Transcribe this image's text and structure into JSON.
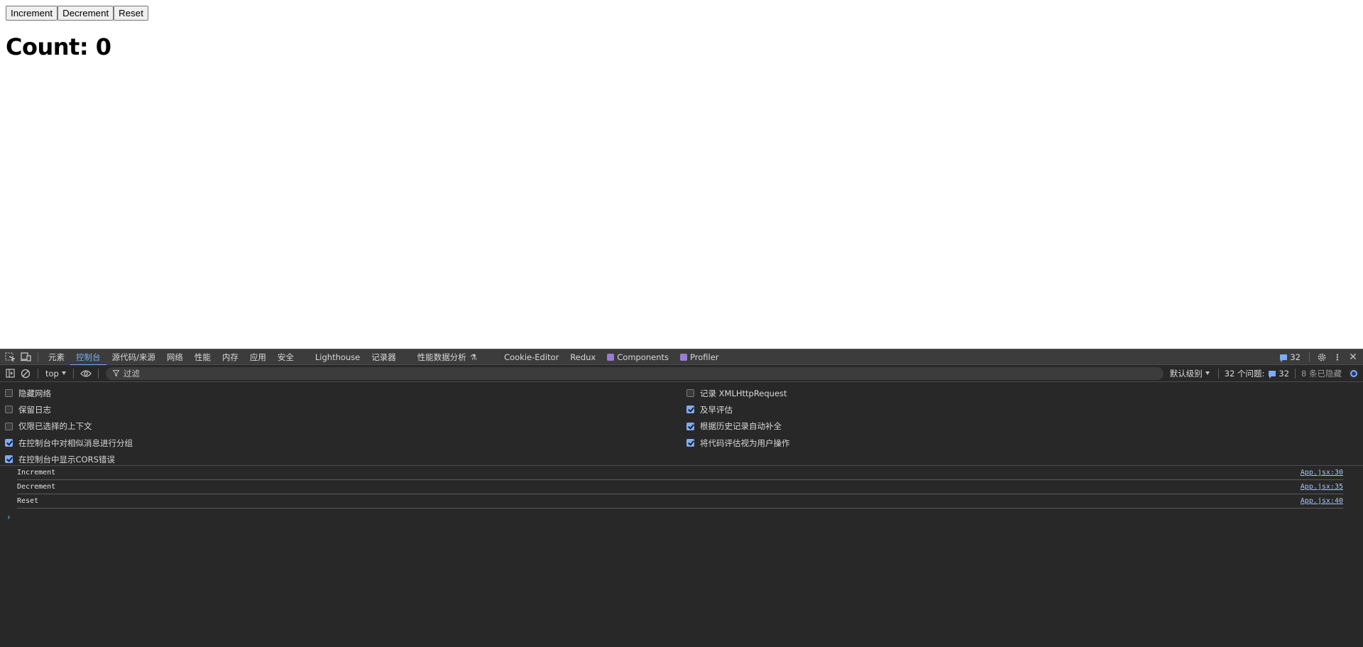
{
  "page": {
    "buttons": [
      "Increment",
      "Decrement",
      "Reset"
    ],
    "count_heading": "Count: 0"
  },
  "devtools": {
    "tabs": [
      {
        "label": "元素",
        "active": false
      },
      {
        "label": "控制台",
        "active": true
      },
      {
        "label": "源代码/来源",
        "active": false
      },
      {
        "label": "网络",
        "active": false
      },
      {
        "label": "性能",
        "active": false
      },
      {
        "label": "内存",
        "active": false
      },
      {
        "label": "应用",
        "active": false
      },
      {
        "label": "安全",
        "active": false
      },
      {
        "label": "Lighthouse",
        "active": false
      },
      {
        "label": "记录器",
        "active": false
      },
      {
        "label": "性能数据分析",
        "active": false
      },
      {
        "label": "Cookie-Editor",
        "active": false
      },
      {
        "label": "Redux",
        "active": false
      },
      {
        "label": "Components",
        "active": false
      },
      {
        "label": "Profiler",
        "active": false
      }
    ],
    "issues_count": "32",
    "toolbar": {
      "context": "top",
      "filter_placeholder": "过滤",
      "level": "默认级别",
      "issues_label": "32 个问题:",
      "issues_count": "32",
      "hidden_label": "8 条已隐藏"
    },
    "settings_left": [
      {
        "label": "隐藏网络",
        "checked": false
      },
      {
        "label": "保留日志",
        "checked": false
      },
      {
        "label": "仅限已选择的上下文",
        "checked": false
      },
      {
        "label": "在控制台中对相似消息进行分组",
        "checked": true
      },
      {
        "label": "在控制台中显示CORS错误",
        "checked": true
      }
    ],
    "settings_right": [
      {
        "label": "记录 XMLHttpRequest",
        "checked": false
      },
      {
        "label": "及早评估",
        "checked": true
      },
      {
        "label": "根据历史记录自动补全",
        "checked": true
      },
      {
        "label": "将代码评估视为用户操作",
        "checked": true
      }
    ],
    "logs": [
      {
        "message": "Increment",
        "source": "App.jsx:30"
      },
      {
        "message": "Decrement",
        "source": "App.jsx:35"
      },
      {
        "message": "Reset",
        "source": "App.jsx:40"
      }
    ],
    "prompt": "›"
  }
}
